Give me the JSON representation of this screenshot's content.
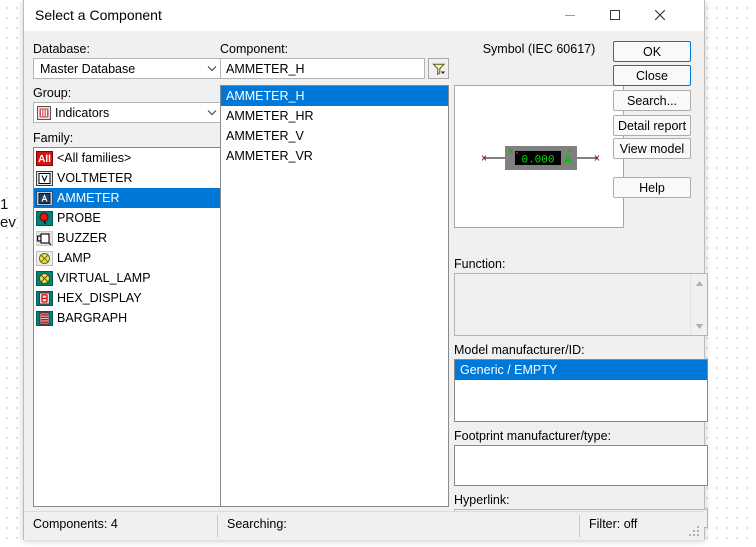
{
  "window": {
    "title": "Select a Component",
    "minimize_label": "—",
    "maximize_label": "□",
    "close_label": "✕"
  },
  "background": {
    "left_text_line1": "1",
    "left_text_line2": "ev"
  },
  "left_panel": {
    "database_label": "Database:",
    "database_value": "Master Database",
    "group_label": "Group:",
    "group_value": "Indicators",
    "group_icon": "indicators-icon",
    "family_label": "Family:",
    "family_items": [
      {
        "label": "<All families>",
        "icon": "all-families-icon",
        "selected": false
      },
      {
        "label": "VOLTMETER",
        "icon": "voltmeter-icon",
        "selected": false
      },
      {
        "label": "AMMETER",
        "icon": "ammeter-icon",
        "selected": true
      },
      {
        "label": "PROBE",
        "icon": "probe-icon",
        "selected": false
      },
      {
        "label": "BUZZER",
        "icon": "buzzer-icon",
        "selected": false
      },
      {
        "label": "LAMP",
        "icon": "lamp-icon",
        "selected": false
      },
      {
        "label": "VIRTUAL_LAMP",
        "icon": "virtual-lamp-icon",
        "selected": false
      },
      {
        "label": "HEX_DISPLAY",
        "icon": "hex-display-icon",
        "selected": false
      },
      {
        "label": "BARGRAPH",
        "icon": "bargraph-icon",
        "selected": false
      }
    ]
  },
  "center_panel": {
    "component_label": "Component:",
    "component_value": "AMMETER_H",
    "component_placeholder": "",
    "filter_icon": "filter-icon",
    "component_items": [
      {
        "label": "AMMETER_H",
        "selected": true
      },
      {
        "label": "AMMETER_HR",
        "selected": false
      },
      {
        "label": "AMMETER_V",
        "selected": false
      },
      {
        "label": "AMMETER_VR",
        "selected": false
      }
    ]
  },
  "right_panel": {
    "symbol_label": "Symbol (IEC 60617)",
    "symbol_icon": "ammeter-symbol",
    "symbol_display_value": "0.000",
    "symbol_unit": "A",
    "function_label": "Function:",
    "function_value": "",
    "model_label": "Model manufacturer/ID:",
    "model_items": [
      {
        "label": "Generic / EMPTY",
        "selected": true
      }
    ],
    "footprint_label": "Footprint manufacturer/type:",
    "footprint_value": "",
    "hyperlink_label": "Hyperlink:",
    "hyperlink_value": ""
  },
  "buttons": {
    "ok": "OK",
    "close": "Close",
    "search": "Search...",
    "detail_report": "Detail report",
    "view_model": "View model",
    "help": "Help"
  },
  "statusbar": {
    "components": "Components: 4",
    "searching": "Searching:",
    "filter": "Filter: off"
  },
  "colors": {
    "selection_blue": "#0078d7",
    "dialog_bg": "#f0f0f0",
    "symbol_body": "#808080",
    "symbol_screen": "#000000",
    "symbol_text_green": "#00e000"
  }
}
